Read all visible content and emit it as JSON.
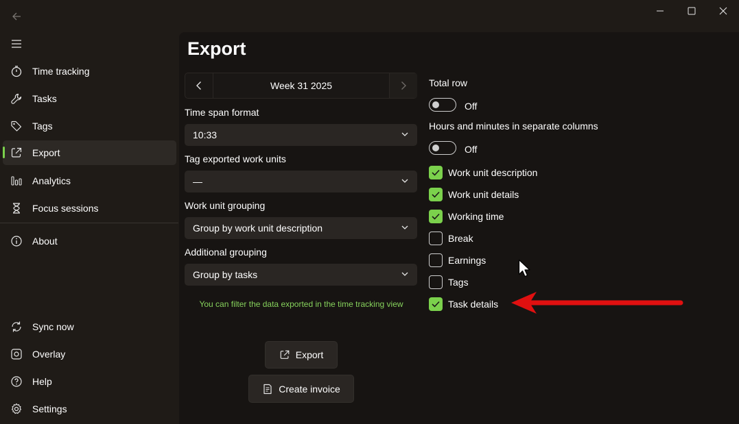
{
  "titlebar": {
    "back_icon": "arrow-left-icon",
    "minimize_icon": "minimize-icon",
    "maximize_icon": "maximize-icon",
    "close_icon": "close-icon"
  },
  "sidebar": {
    "menu_icon": "hamburger-icon",
    "items": [
      {
        "label": "Time tracking",
        "icon": "stopwatch-icon"
      },
      {
        "label": "Tasks",
        "icon": "wrench-icon"
      },
      {
        "label": "Tags",
        "icon": "tag-icon"
      },
      {
        "label": "Export",
        "icon": "share-icon",
        "selected": true
      },
      {
        "label": "Analytics",
        "icon": "bar-chart-icon"
      },
      {
        "label": "Focus sessions",
        "icon": "hourglass-icon"
      },
      {
        "label": "About",
        "icon": "info-icon"
      }
    ],
    "footer_items": [
      {
        "label": "Sync now",
        "icon": "sync-icon"
      },
      {
        "label": "Overlay",
        "icon": "overlay-icon"
      },
      {
        "label": "Help",
        "icon": "help-icon"
      },
      {
        "label": "Settings",
        "icon": "gear-icon"
      }
    ],
    "accent_color": "#7bd14c"
  },
  "page": {
    "title": "Export",
    "week_label": "Week 31 2025",
    "time_span_format": {
      "label": "Time span format",
      "value": "10:33"
    },
    "tag_exported": {
      "label": "Tag exported work units",
      "value": "—"
    },
    "work_unit_grouping": {
      "label": "Work unit grouping",
      "value": "Group by work unit description"
    },
    "additional_grouping": {
      "label": "Additional grouping",
      "value": "Group by tasks"
    },
    "hint": "You can filter the data exported in the time tracking view",
    "export_button": "Export",
    "invoice_button": "Create invoice"
  },
  "options": {
    "total_row": {
      "label": "Total row",
      "state": "Off"
    },
    "separate_columns": {
      "label": "Hours and minutes in separate columns",
      "state": "Off"
    },
    "checkboxes": [
      {
        "label": "Work unit description",
        "checked": true
      },
      {
        "label": "Work unit details",
        "checked": true
      },
      {
        "label": "Working time",
        "checked": true
      },
      {
        "label": "Break",
        "checked": false
      },
      {
        "label": "Earnings",
        "checked": false
      },
      {
        "label": "Tags",
        "checked": false
      },
      {
        "label": "Task details",
        "checked": true
      }
    ]
  },
  "annotation": {
    "arrow_color": "#e01010"
  }
}
